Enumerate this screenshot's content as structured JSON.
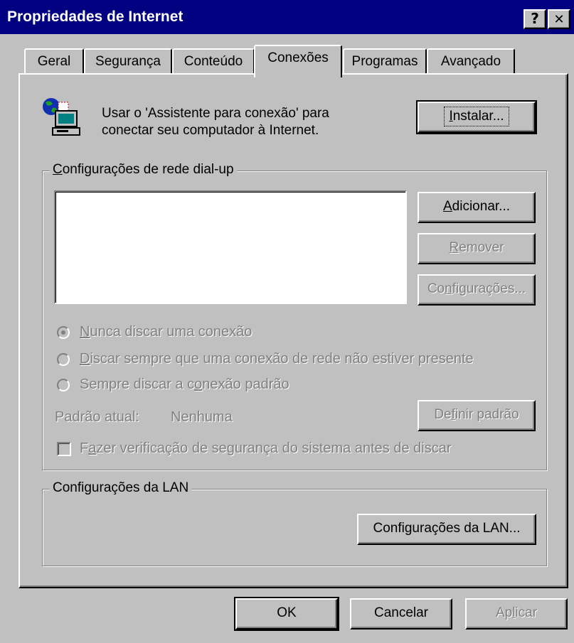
{
  "window": {
    "title": "Propriedades de Internet",
    "help_glyph": "?",
    "close_glyph": "✕"
  },
  "tabs": [
    {
      "label": "Geral",
      "active": false
    },
    {
      "label": "Segurança",
      "active": false
    },
    {
      "label": "Conteúdo",
      "active": false
    },
    {
      "label": "Conexões",
      "active": true
    },
    {
      "label": "Programas",
      "active": false
    },
    {
      "label": "Avançado",
      "active": false
    }
  ],
  "wizard": {
    "icon": "connection-wizard-icon",
    "line1": "Usar o 'Assistente para conexão' para",
    "line2": "conectar seu computador à Internet.",
    "install": {
      "pre": "",
      "u": "I",
      "post": "nstalar..."
    }
  },
  "dialup": {
    "title": {
      "pre": "",
      "u": "C",
      "post": "onfigurações de rede dial-up"
    },
    "add": {
      "pre": "",
      "u": "A",
      "post": "dicionar..."
    },
    "remove": {
      "pre": "",
      "u": "R",
      "post": "emover"
    },
    "settings": {
      "pre": "Co",
      "u": "n",
      "post": "figurações..."
    },
    "radio_never": {
      "pre": "",
      "u": "N",
      "post": "unca discar uma conexão",
      "selected": true
    },
    "radio_whenever": {
      "pre": "",
      "u": "D",
      "post": "iscar sempre que uma conexão de rede não estiver presente",
      "selected": false
    },
    "radio_always": {
      "pre": "Sempre discar a c",
      "u": "o",
      "post": "nexão padrão",
      "selected": false
    },
    "current_default_label": "Padrão atual:",
    "current_default_value": "Nenhuma",
    "set_default": {
      "pre": "De",
      "u": "f",
      "post": "inir padrão"
    },
    "security_check": {
      "pre": "F",
      "u": "a",
      "post": "zer verificação de segurança do sistema antes de discar",
      "checked": false
    }
  },
  "lan": {
    "title": "Configurações da LAN",
    "button": {
      "pre": "Confi",
      "u": "g",
      "post": "urações da LAN..."
    }
  },
  "footer": {
    "ok": "OK",
    "cancel": "Cancelar",
    "apply": {
      "pre": "Ap",
      "u": "l",
      "post": "icar"
    }
  },
  "colors": {
    "face": "#c0c0c0",
    "titlebar": "#000080",
    "disabled": "#808080"
  }
}
